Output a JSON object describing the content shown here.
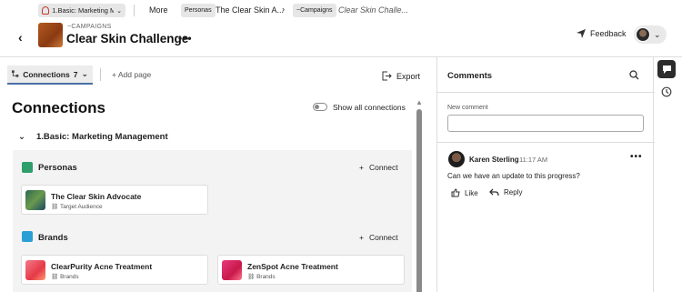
{
  "breadcrumbs": {
    "workspace": "1.Basic: Marketing M...",
    "more": "More",
    "personas_chip": "Personas",
    "persona_name": "The Clear Skin A...",
    "campaigns_chip": "~Campaigns",
    "current": "Clear Skin Challe..."
  },
  "header": {
    "subtitle": "~CAMPAIGNS",
    "title": "Clear Skin Challenge",
    "more": "•••",
    "feedback": "Feedback"
  },
  "tabs": {
    "connections_label": "Connections",
    "connections_count": "7",
    "add_page": "Add page",
    "export": "Export"
  },
  "main": {
    "heading": "Connections",
    "show_all": "Show all connections",
    "section": "1.Basic: Marketing Management",
    "connect": "Connect",
    "groups": [
      {
        "title": "Personas",
        "color": "#2e9e6b",
        "cards": [
          {
            "name": "The Clear Skin Advocate",
            "type": "Target Audience"
          }
        ]
      },
      {
        "title": "Brands",
        "color": "#2a9fd6",
        "cards": [
          {
            "name": "ClearPurity Acne Treatment",
            "type": "Brands"
          },
          {
            "name": "ZenSpot Acne Treatment",
            "type": "Brands"
          }
        ]
      }
    ]
  },
  "comments": {
    "title": "Comments",
    "new_label": "New comment",
    "new_placeholder": "",
    "items": [
      {
        "author": "Karen Sterling",
        "time": "11:17 AM",
        "text": "Can we have an update to this progress?",
        "like": "Like",
        "reply": "Reply"
      }
    ]
  },
  "colors": {
    "accent": "#4a6fa5",
    "rail_active": "#2c2c2c"
  }
}
